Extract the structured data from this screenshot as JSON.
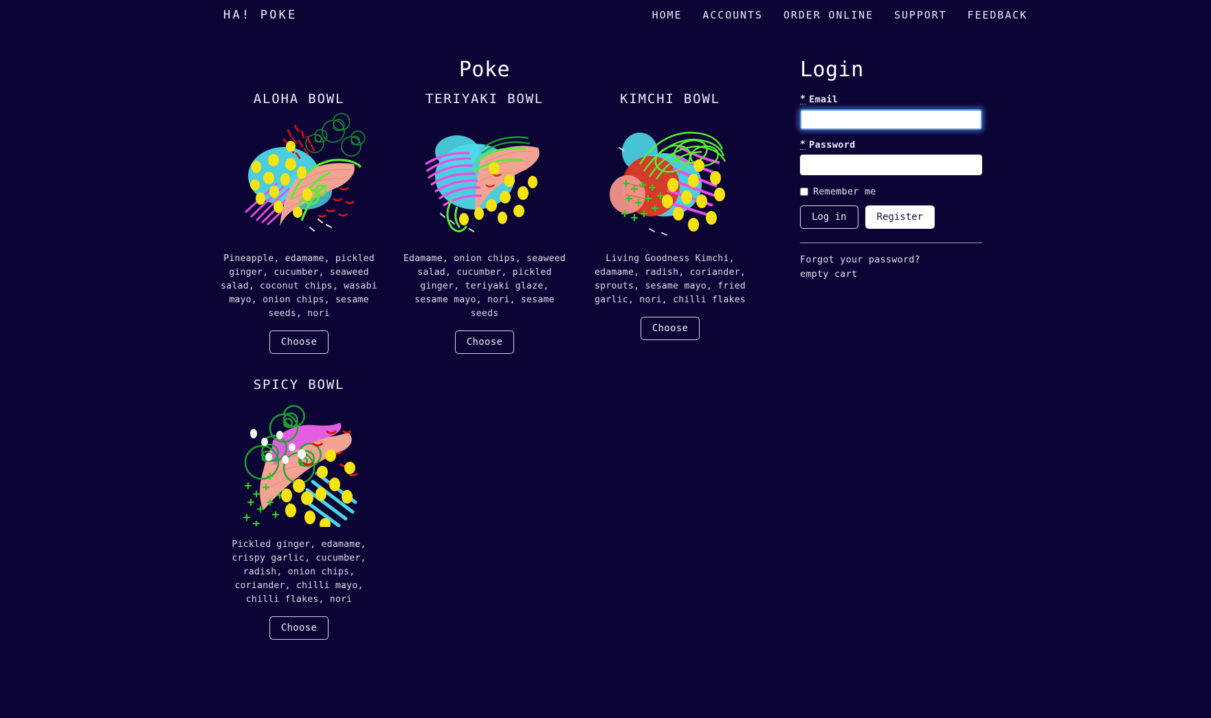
{
  "navbar": {
    "brand": "HA! POKE",
    "links": [
      {
        "label": "HOME"
      },
      {
        "label": "ACCOUNTS"
      },
      {
        "label": "ORDER ONLINE"
      },
      {
        "label": "SUPPORT"
      },
      {
        "label": "FEEDBACK"
      }
    ]
  },
  "menu": {
    "title": "Poke",
    "bowls": [
      {
        "name": "ALOHA BOWL",
        "description": "Pineapple, edamame, pickled ginger, cucumber, seaweed salad, coconut chips, wasabi mayo, onion chips, sesame seeds, nori",
        "choose_label": "Choose",
        "art": "aloha-bowl-illustration"
      },
      {
        "name": "TERIYAKI BOWL",
        "description": "Edamame, onion chips, seaweed salad, cucumber, pickled ginger, teriyaki glaze, sesame mayo, nori, sesame seeds",
        "choose_label": "Choose",
        "art": "teriyaki-bowl-illustration"
      },
      {
        "name": "KIMCHI BOWL",
        "description": "Living Goodness Kimchi, edamame, radish, coriander, sprouts, sesame mayo, fried garlic, nori, chilli flakes",
        "choose_label": "Choose",
        "art": "kimchi-bowl-illustration"
      },
      {
        "name": "SPICY BOWL",
        "description": "Pickled ginger, edamame, crispy garlic, cucumber, radish, onion chips, coriander, chilli mayo, chilli flakes, nori",
        "choose_label": "Choose",
        "art": "spicy-bowl-illustration"
      }
    ]
  },
  "login": {
    "title": "Login",
    "required_marker": "*",
    "email_label": "Email",
    "email_value": "",
    "email_placeholder": "",
    "password_label": "Password",
    "password_value": "",
    "password_placeholder": "",
    "remember_label": "Remember me",
    "remember_checked": false,
    "login_button": "Log in",
    "register_button": "Register",
    "forgot_link": "Forgot your password?",
    "cart_link": "empty cart"
  },
  "colors": {
    "background": "#0c0435",
    "text": "#e8e8f0",
    "focus_border": "#5599e8",
    "button_fill": "#ffffff"
  }
}
